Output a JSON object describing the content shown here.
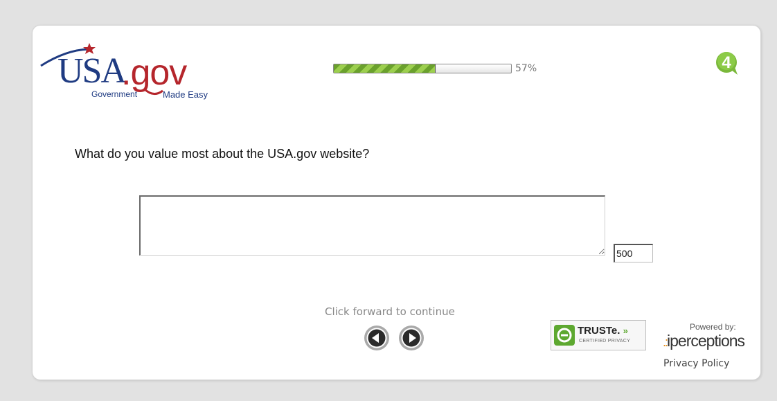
{
  "logo": {
    "main_usa": "USA",
    "main_gov": ".gov",
    "tagline_left": "Government",
    "tagline_right": "Made Easy",
    "colors": {
      "blue": "#1f3b82",
      "red": "#b5262c"
    }
  },
  "progress": {
    "percent_label": "57%",
    "fraction": 0.57
  },
  "badge": {
    "label": "4",
    "icon": "green-speech-bubble-icon",
    "color": "#7ab83a"
  },
  "survey": {
    "question": "What do you value most about the USA.gov website?",
    "answer_value": "",
    "char_counter": "500"
  },
  "navigation": {
    "hint": "Click forward to continue",
    "back_icon": "circle-arrow-left-icon",
    "forward_icon": "circle-arrow-right-icon"
  },
  "footer": {
    "truste_name": "TRUSTe.",
    "truste_chevrons": "»",
    "truste_subtitle": "CERTIFIED PRIVACY",
    "powered_by": "Powered by:",
    "brand_dots": ".:",
    "brand_name": "iperceptions",
    "privacy_link": "Privacy Policy"
  }
}
